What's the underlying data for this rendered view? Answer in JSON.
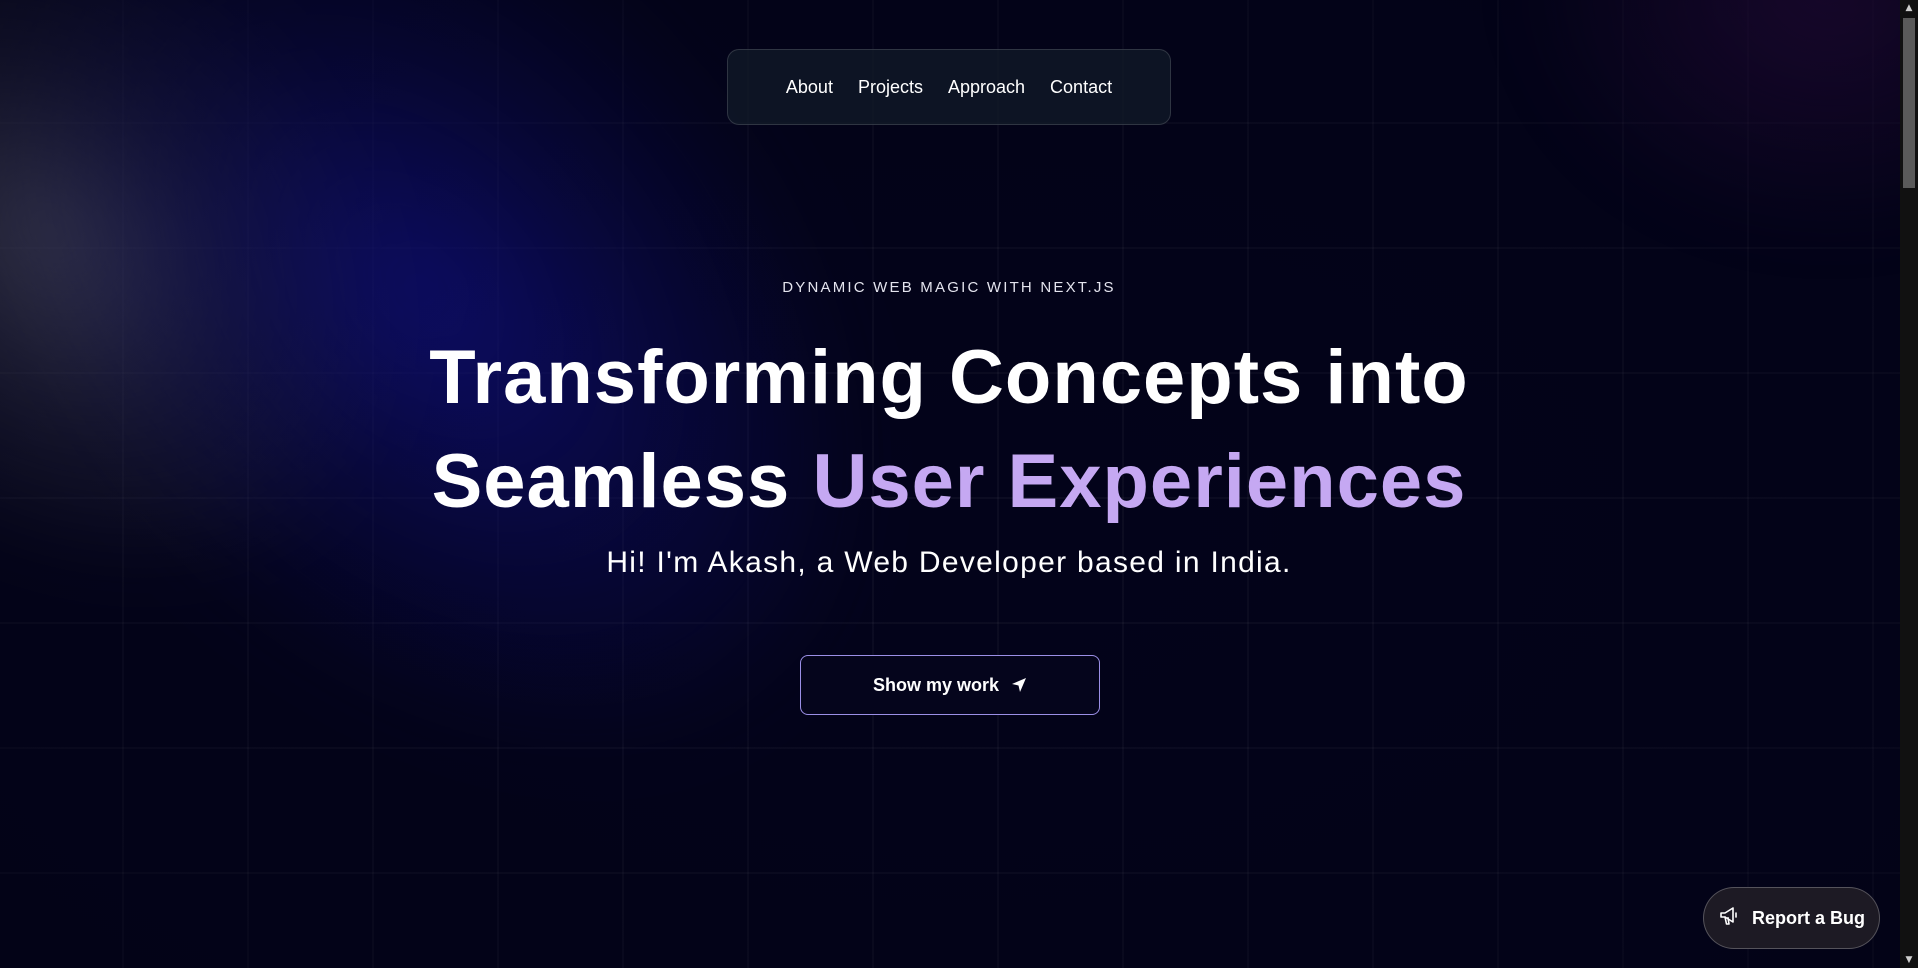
{
  "nav": {
    "items": [
      {
        "label": "About"
      },
      {
        "label": "Projects"
      },
      {
        "label": "Approach"
      },
      {
        "label": "Contact"
      }
    ]
  },
  "hero": {
    "eyebrow": "DYNAMIC WEB MAGIC WITH NEXT.JS",
    "headline_line1": "Transforming Concepts into",
    "headline_line2_plain": "Seamless ",
    "headline_line2_accent": "User Experiences",
    "subtitle": "Hi! I'm Akash, a Web Developer based in India.",
    "cta_label": "Show my work",
    "cta_icon": "location-arrow-icon"
  },
  "report_bug": {
    "label": "Report a Bug",
    "icon": "megaphone-icon"
  },
  "colors": {
    "background": "#03031a",
    "accent": "#c5a8f2",
    "cta_border": "#9b8fe6",
    "navbar_bg": "#111928"
  }
}
